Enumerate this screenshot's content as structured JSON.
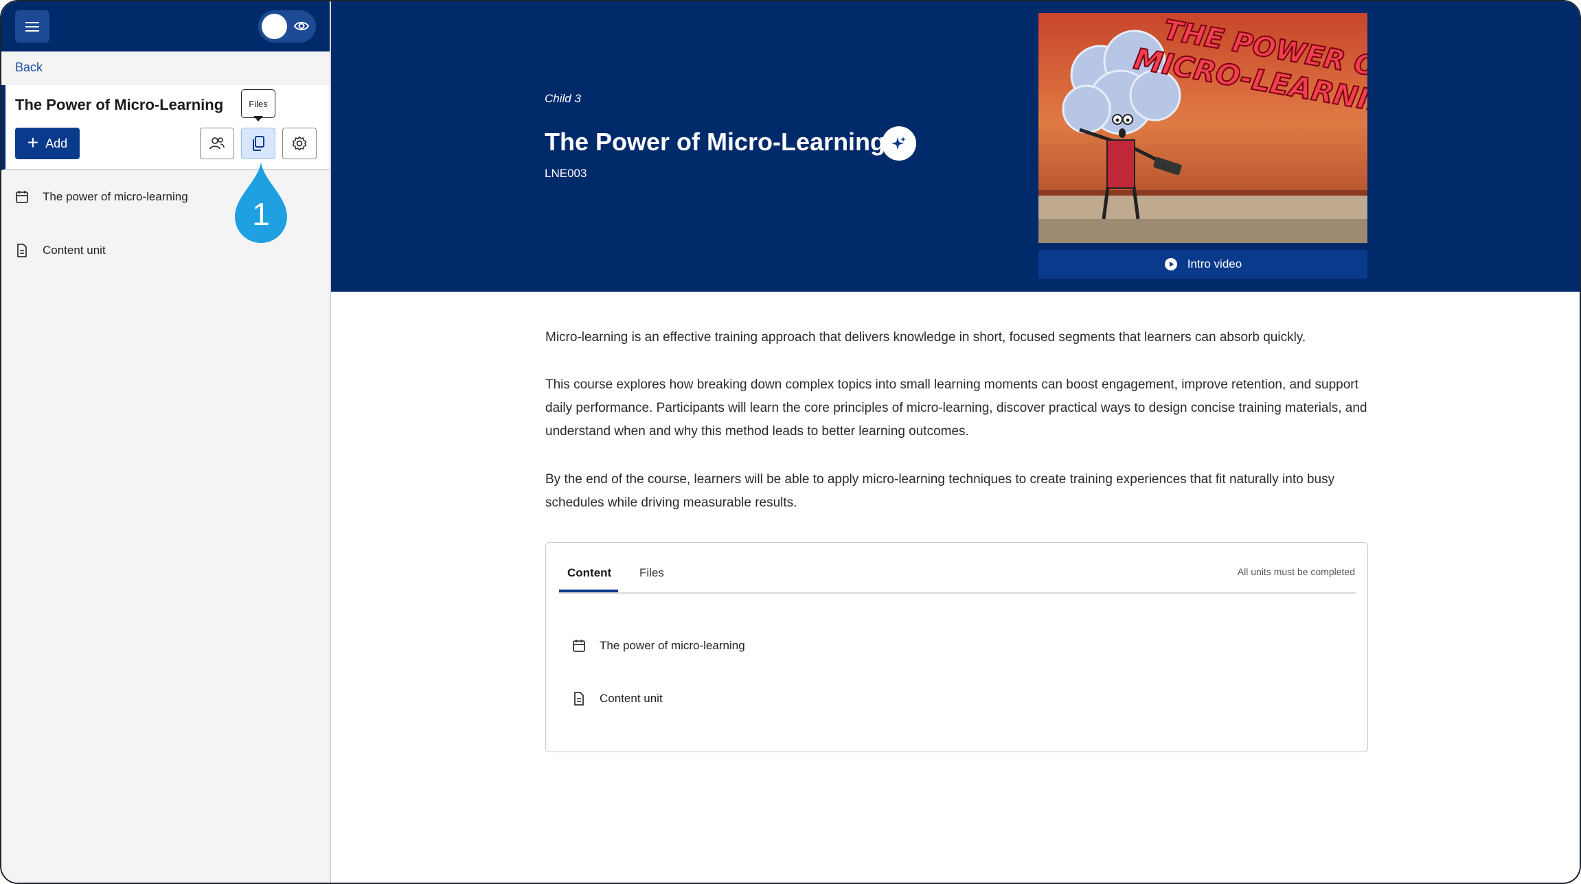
{
  "sidebar": {
    "back_label": "Back",
    "course_title": "The Power of Micro-Learning",
    "add_label": "Add",
    "tooltip": "Files",
    "step_marker": "1",
    "items": [
      {
        "label": "The power of micro-learning",
        "icon": "calendar-icon"
      },
      {
        "label": "Content unit",
        "icon": "document-icon"
      }
    ]
  },
  "hero": {
    "child_label": "Child 3",
    "title": "The Power of Micro-Learning",
    "code": "LNE003",
    "thumbnail_text_line1": "THE POWER OF",
    "thumbnail_text_line2": "MICRO-LEARNING",
    "intro_button": "Intro video"
  },
  "description": [
    "Micro-learning is an effective training approach that delivers knowledge in short, focused segments that learners can absorb quickly.",
    "This course explores how breaking down complex topics into small learning moments can boost engagement, improve retention, and support daily performance. Participants will learn the core principles of micro-learning, discover practical ways to design concise training materials, and understand when and why this method leads to better learning outcomes.",
    "By the end of the course, learners will be able to apply micro-learning techniques to create training experiences that fit naturally into busy schedules while driving measurable results."
  ],
  "content_card": {
    "tabs": [
      {
        "label": "Content"
      },
      {
        "label": "Files"
      }
    ],
    "completion_note": "All units must be completed",
    "items": [
      {
        "label": "The power of micro-learning",
        "icon": "calendar-icon"
      },
      {
        "label": "Content unit",
        "icon": "document-icon"
      }
    ]
  },
  "colors": {
    "navy": "#012a6b",
    "button_blue": "#0a3a8c",
    "marker_blue": "#1fa0e0",
    "active_icon_bg": "#d7e6fb"
  }
}
